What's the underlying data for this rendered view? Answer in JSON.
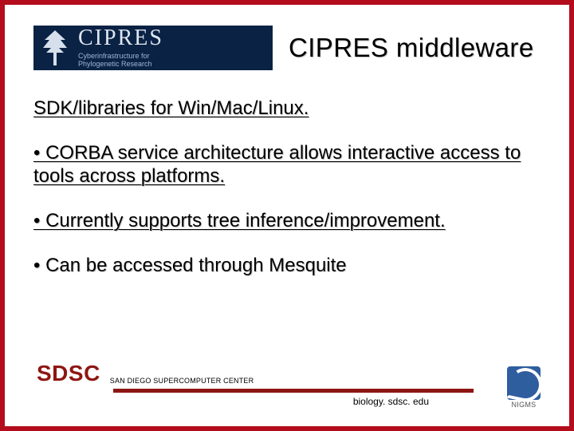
{
  "header": {
    "logo": {
      "name": "CIPRES",
      "subtitle_line1": "Cyberinfrastructure for",
      "subtitle_line2": "Phylogenetic Research"
    },
    "title": "CIPRES middleware"
  },
  "body": {
    "subtitle": "SDK/libraries for Win/Mac/Linux.",
    "bullets": [
      "CORBA service architecture allows interactive access to tools across platforms.",
      "Currently supports tree inference/improvement.",
      "Can be accessed through Mesquite"
    ]
  },
  "footer": {
    "sdsc_logo": "SDSC",
    "sdsc_full": "SAN DIEGO SUPERCOMPUTER CENTER",
    "url": "biology. sdsc. edu",
    "nigms": "NIGMS"
  },
  "colors": {
    "border": "#b30c1c",
    "logo_bg": "#0a2244",
    "sdsc": "#8e1612",
    "nigms": "#2f5e9e"
  }
}
